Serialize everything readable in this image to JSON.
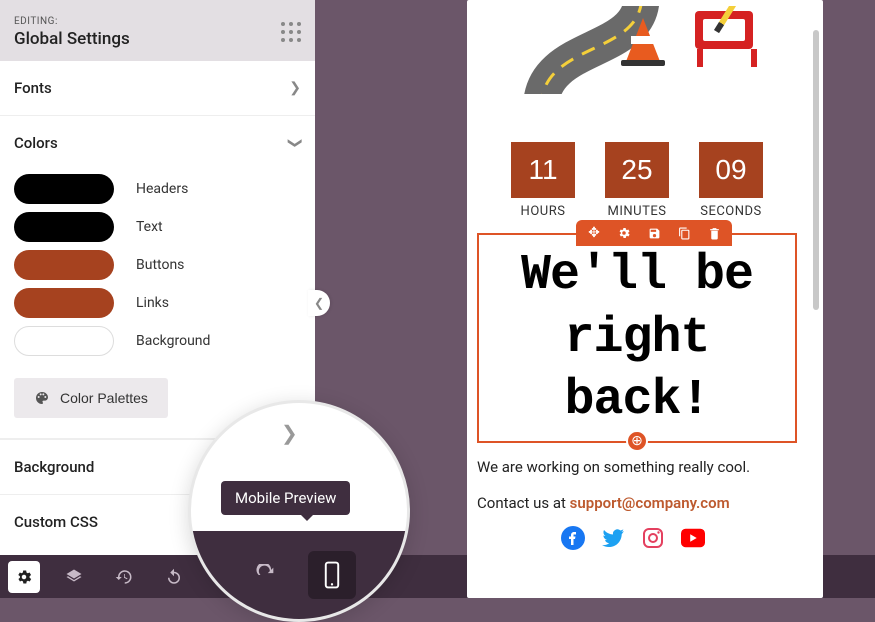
{
  "sidebar": {
    "editing_label": "EDITING:",
    "title": "Global Settings",
    "fonts_label": "Fonts",
    "colors_label": "Colors",
    "colors": [
      {
        "label": "Headers",
        "hex": "#000000"
      },
      {
        "label": "Text",
        "hex": "#000000"
      },
      {
        "label": "Buttons",
        "hex": "#a6421f"
      },
      {
        "label": "Links",
        "hex": "#a6421f"
      },
      {
        "label": "Background",
        "hex": "#ffffff"
      }
    ],
    "palettes_label": "Color Palettes",
    "background_label": "Background",
    "custom_css_label": "Custom CSS"
  },
  "tooltip": {
    "label": "Mobile Preview"
  },
  "preview": {
    "countdown": {
      "hours": {
        "value": "11",
        "label": "HOURS"
      },
      "minutes": {
        "value": "25",
        "label": "MINUTES"
      },
      "seconds": {
        "value": "09",
        "label": "SECONDS"
      }
    },
    "heading": "We'll be right back!",
    "subtext": "We are working on something really cool.",
    "contact_prefix": "Contact us at ",
    "contact_link": "support@company.com",
    "social_icons": [
      "facebook",
      "twitter",
      "instagram",
      "youtube"
    ]
  }
}
